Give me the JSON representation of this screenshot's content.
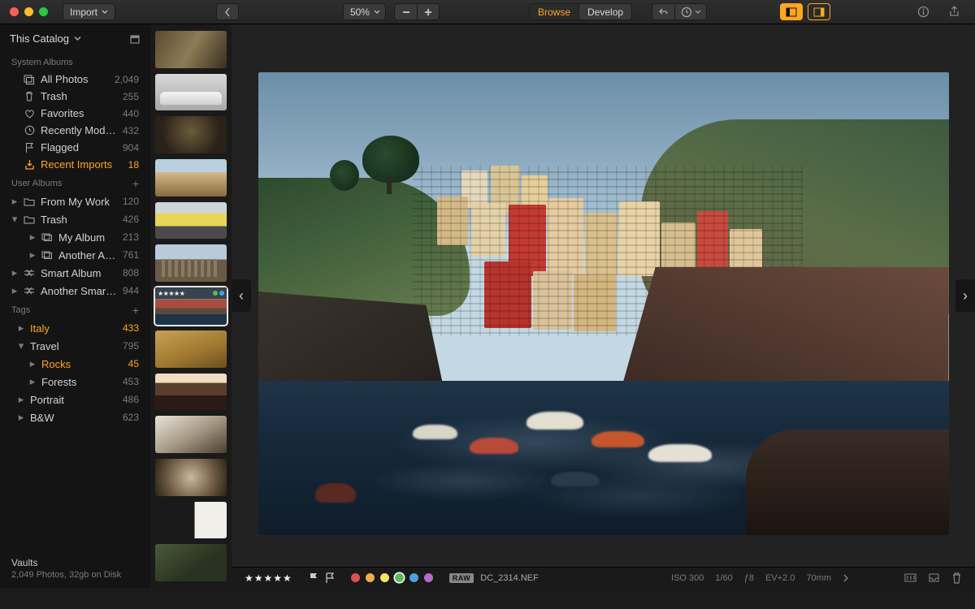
{
  "toolbar": {
    "import": "Import",
    "zoom": "50%",
    "mode": {
      "browse": "Browse",
      "develop": "Develop"
    }
  },
  "sidebar": {
    "catalog": "This Catalog",
    "system_title": "System Albums",
    "system": [
      {
        "label": "All Photos",
        "count": "2,049",
        "icon": "photos"
      },
      {
        "label": "Trash",
        "count": "255",
        "icon": "trash"
      },
      {
        "label": "Favorites",
        "count": "440",
        "icon": "heart"
      },
      {
        "label": "Recently Modified",
        "count": "432",
        "icon": "clock"
      },
      {
        "label": "Flagged",
        "count": "904",
        "icon": "flag"
      },
      {
        "label": "Recent Imports",
        "count": "18",
        "icon": "import",
        "selected": true
      }
    ],
    "user_title": "User Albums",
    "user": [
      {
        "label": "From My Work",
        "count": "120",
        "icon": "folder",
        "exp": "▸"
      },
      {
        "label": "Trash",
        "count": "426",
        "icon": "folder",
        "exp": "▾"
      },
      {
        "label": "My Album",
        "count": "213",
        "icon": "album",
        "sub": 2,
        "exp": "▸"
      },
      {
        "label": "Another Album",
        "count": "761",
        "icon": "album",
        "sub": 2,
        "exp": "▸"
      },
      {
        "label": "Smart Album",
        "count": "808",
        "icon": "smart",
        "exp": "▸"
      },
      {
        "label": "Another Smart A…",
        "count": "944",
        "icon": "smart",
        "exp": "▸"
      }
    ],
    "tags_title": "Tags",
    "tags": [
      {
        "label": "Italy",
        "count": "433",
        "exp": "▸",
        "accent": true
      },
      {
        "label": "Travel",
        "count": "795",
        "exp": "▾"
      },
      {
        "label": "Rocks",
        "count": "45",
        "sub": 2,
        "exp": "▸",
        "accent": true
      },
      {
        "label": "Forests",
        "count": "453",
        "sub": 2,
        "exp": "▸"
      },
      {
        "label": "Portrait",
        "count": "486",
        "exp": "▸"
      },
      {
        "label": "B&W",
        "count": "623",
        "exp": "▸"
      }
    ],
    "vaults_title": "Vaults",
    "vaults_sub": "2,049 Photos, 32gb on Disk"
  },
  "bottombar": {
    "stars": "★★★★★",
    "raw": "RAW",
    "filename": "DC_2314.NEF",
    "iso": "ISO 300",
    "shutter": "1/60",
    "aperture": "ƒ8",
    "ev": "EV+2.0",
    "focal": "70mm",
    "colors": [
      {
        "c": "#d9534f"
      },
      {
        "c": "#f0ad4e"
      },
      {
        "c": "#f7e463"
      },
      {
        "c": "#5cb85c",
        "sel": true
      },
      {
        "c": "#4aa3df"
      },
      {
        "c": "#b66bd1"
      }
    ]
  }
}
